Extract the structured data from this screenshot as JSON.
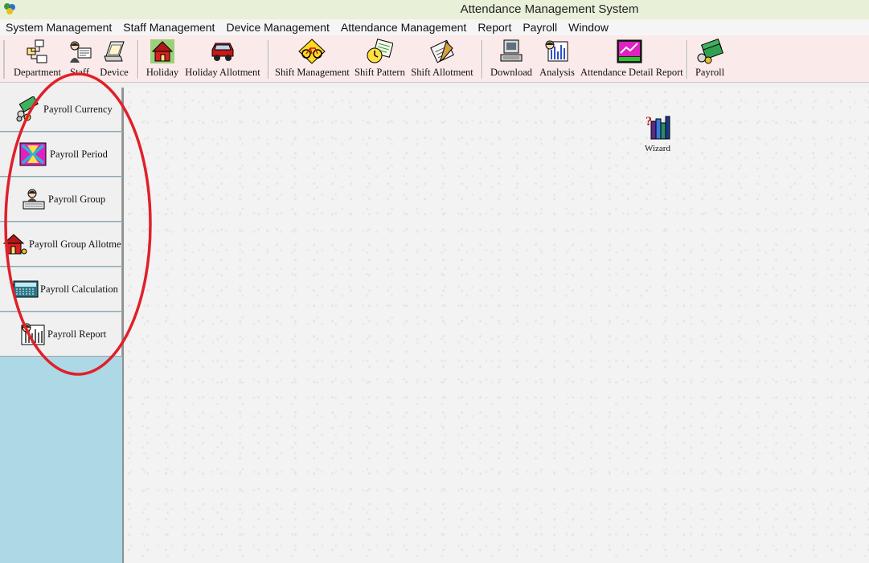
{
  "window": {
    "title": "Attendance Management System"
  },
  "menu": [
    "System Management",
    "Staff Management",
    "Device Management",
    "Attendance Management",
    "Report",
    "Payroll",
    "Window"
  ],
  "toolbar": {
    "department": "Department",
    "staff": "Staff",
    "device": "Device",
    "holiday": "Holiday",
    "holiday_allotment": "Holiday Allotment",
    "shift_management": "Shift Management",
    "shift_pattern": "Shift Pattern",
    "shift_allotment": "Shift Allotment",
    "download": "Download",
    "analysis": "Analysis",
    "attendance_detail_report": "Attendance Detail Report",
    "payroll": "Payroll"
  },
  "sidebar": [
    {
      "label": "Payroll Currency",
      "icon": "currency-icon"
    },
    {
      "label": "Payroll Period",
      "icon": "period-icon"
    },
    {
      "label": "Payroll Group",
      "icon": "group-icon"
    },
    {
      "label": "Payroll Group Allotmen",
      "icon": "allotment-icon"
    },
    {
      "label": "Payroll Calculation",
      "icon": "calculator-icon"
    },
    {
      "label": "Payroll Report",
      "icon": "report-icon"
    }
  ],
  "workspace": {
    "wizard_label": "Wizard"
  },
  "colors": {
    "toolbar_bg": "#fbeaea",
    "sidebar_bg": "#add8e6",
    "highlight": "#e0202a"
  }
}
